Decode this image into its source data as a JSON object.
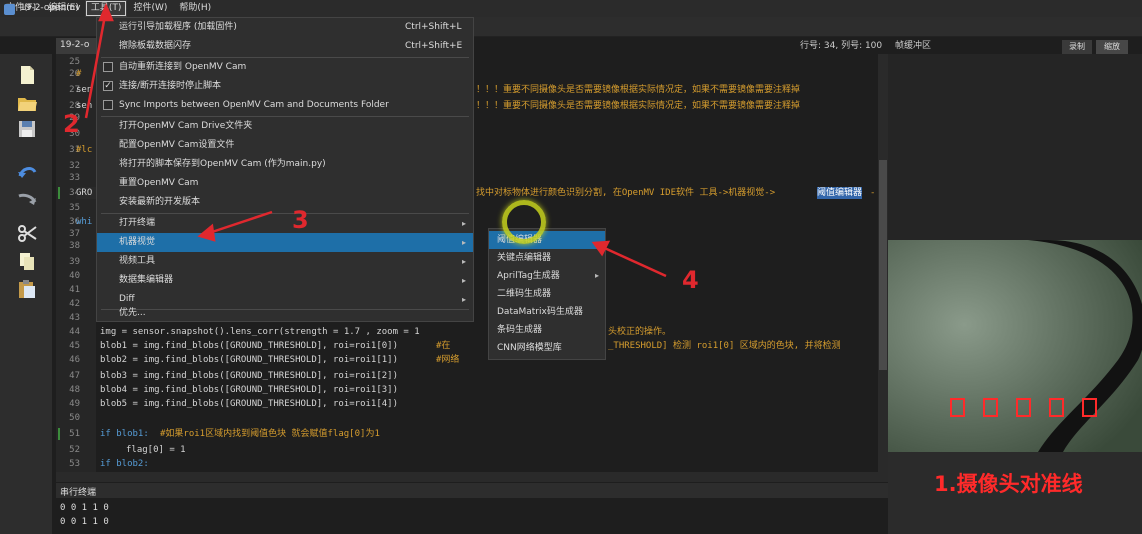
{
  "menubar": {
    "items": [
      "文件(F)",
      "编辑(E)",
      "工具(T)",
      "控件(W)",
      "帮助(H)"
    ]
  },
  "title": "19-2-openmv",
  "editor_tab": "19-2-o",
  "status": {
    "position": "行号: 34, 列号: 100",
    "framebuffer": "帧缓冲区",
    "record": "录制",
    "zoom": "缩放"
  },
  "tools_menu": {
    "items": [
      {
        "label": "运行引导加载程序 (加载固件)",
        "shortcut": "Ctrl+Shift+L"
      },
      {
        "label": "擦除板载数据闪存",
        "shortcut": "Ctrl+Shift+E"
      },
      {
        "label": "自动重新连接到 OpenMV Cam"
      },
      {
        "label": "连接/断开连接时停止脚本",
        "check": "✓"
      },
      {
        "label": "Sync Imports between OpenMV Cam and Documents Folder"
      },
      {
        "label": "打开OpenMV Cam Drive文件夹"
      },
      {
        "label": "配置OpenMV Cam设置文件"
      },
      {
        "label": "将打开的脚本保存到OpenMV Cam (作为main.py)"
      },
      {
        "label": "重置OpenMV Cam"
      },
      {
        "label": "安装最新的开发版本"
      },
      {
        "label": "打开终端"
      },
      {
        "label": "机器视觉"
      },
      {
        "label": "视频工具"
      },
      {
        "label": "数据集编辑器"
      },
      {
        "label": "Diff"
      },
      {
        "label": "优先..."
      }
    ]
  },
  "vision_submenu": {
    "items": [
      "阈值编辑器",
      "关键点编辑器",
      "AprilTag生成器",
      "二维码生成器",
      "DataMatrix码生成器",
      "条码生成器",
      "CNN网络模型库"
    ]
  },
  "line_numbers": [
    "25",
    "26",
    "27",
    "28",
    "29",
    "30",
    "31",
    "32",
    "33",
    "34",
    "35",
    "36",
    "37",
    "38",
    "39",
    "40",
    "41",
    "42",
    "43",
    "44",
    "45",
    "46",
    "47",
    "48",
    "49",
    "50",
    "51",
    "52",
    "53"
  ],
  "code": {
    "l26": "#",
    "l27": "sen",
    "l27c": "！！！重要不同摄像头是否需要镜像根据实际情况定，如果不需要镜像需要注释掉",
    "l28": "sen",
    "l28c": "！！！重要不同摄像头是否需要镜像根据实际情况定，如果不需要镜像需要注释掉",
    "l31": "#lc",
    "l34": "GRO",
    "l34c": "找中对标物体进行颜色识别分割, 在OpenMV IDE软件 工具->机器视觉->",
    "l34h": "阈值编辑器",
    "l34t": "-",
    "l36": "whi",
    "l44a": "img = sensor.snapshot().lens_corr(strength = 1.7 , zoom = 1",
    "l44c": "头校正的操作。",
    "l45a": "blob1 = img.find_blobs([GROUND_THRESHOLD], roi=roi1[0])",
    "l45c": "#在",
    "l45d": "_THRESHOLD] 检测 roi1[0] 区域内的色块, 并将检测",
    "l46a": "blob2 = img.find_blobs([GROUND_THRESHOLD], roi=roi1[1])",
    "l46c": "#网络",
    "l47": "blob3 = img.find_blobs([GROUND_THRESHOLD], roi=roi1[2])",
    "l48": "blob4 = img.find_blobs([GROUND_THRESHOLD], roi=roi1[3])",
    "l49": "blob5 = img.find_blobs([GROUND_THRESHOLD], roi=roi1[4])",
    "l51a": "if blob1:",
    "l51c": "#如果roi1区域内找到阈值色块 就会赋值flag[0]为1",
    "l52": "flag[0] = 1",
    "l53": "if blob2:"
  },
  "serial": {
    "title": "串行终端",
    "lines": [
      "0 0 1 1 0",
      "0 0 1 1 0"
    ]
  },
  "framebuffer_caption": "1.摄像头对准线",
  "annotations": {
    "a2": "2",
    "a3": "3",
    "a4": "4"
  },
  "colors": {
    "accent": "#1e6fa8",
    "annotation": "#e0282e"
  }
}
